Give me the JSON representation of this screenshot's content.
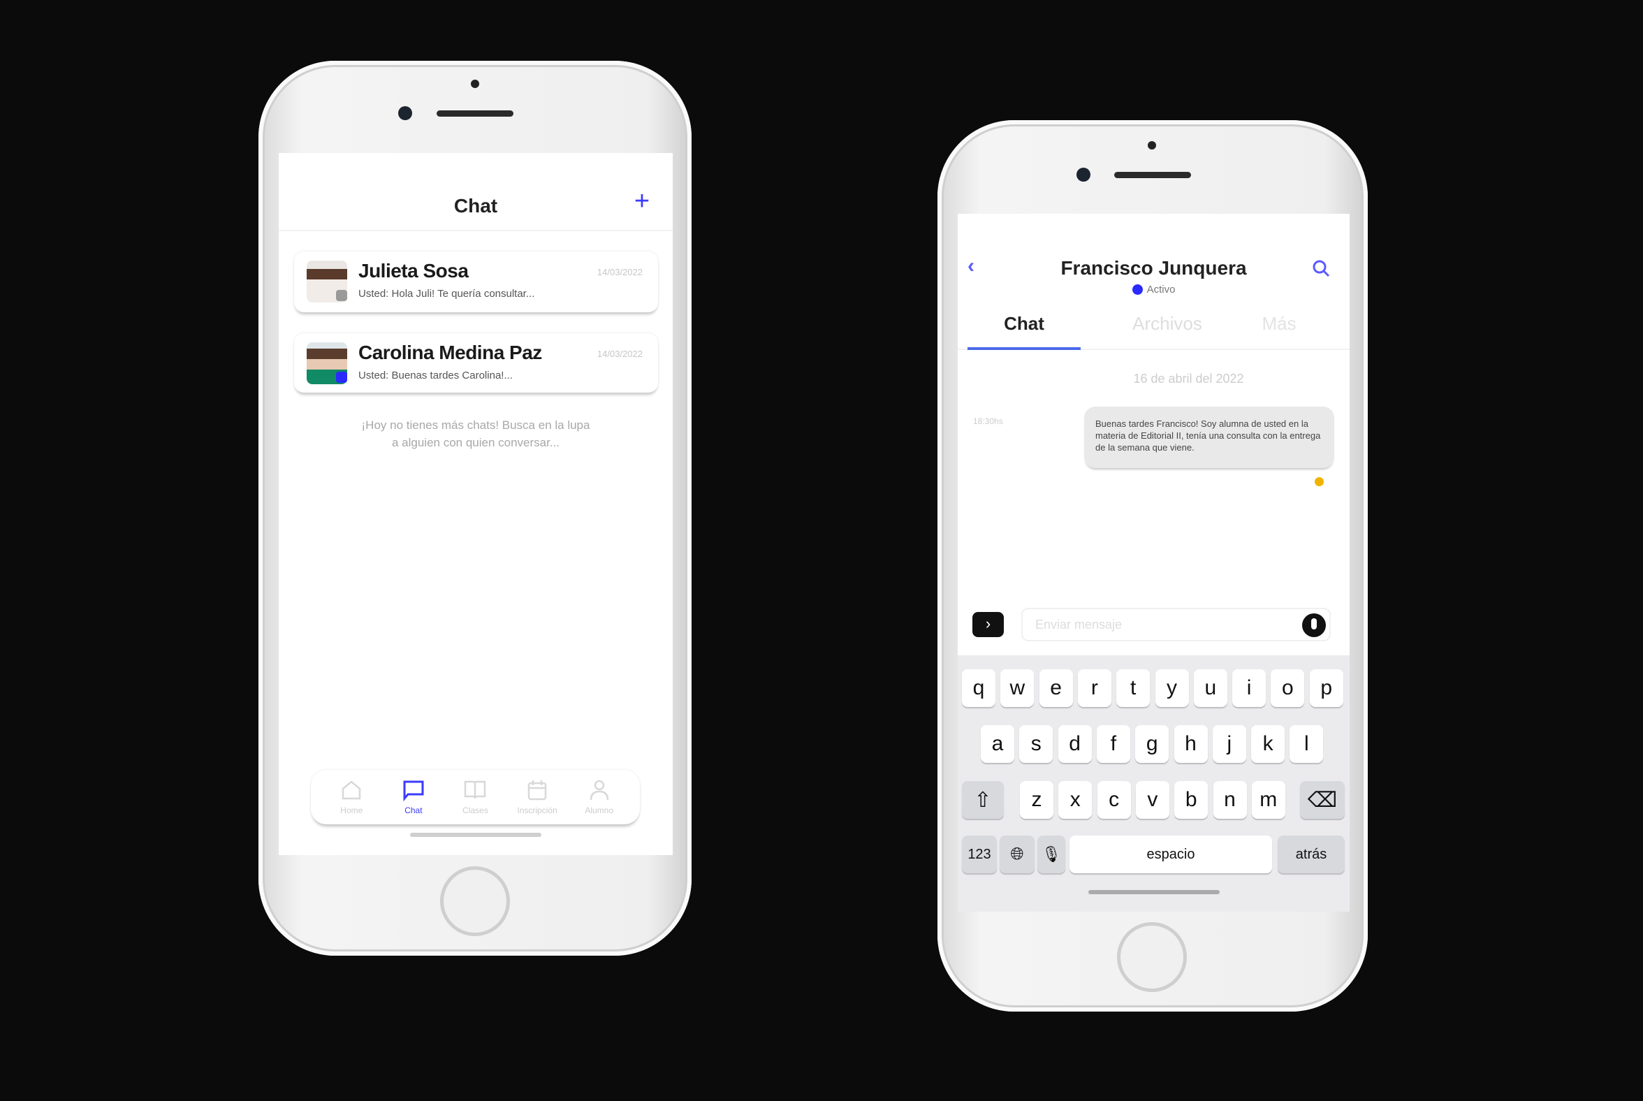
{
  "left_phone": {
    "header": {
      "title": "Chat",
      "add_icon": "plus-icon"
    },
    "chats": [
      {
        "name": "Julieta Sosa",
        "preview": "Usted: Hola Juli! Te quería consultar...",
        "date": "14/03/2022",
        "status_color": "#9a9a9a"
      },
      {
        "name": "Carolina Medina Paz",
        "preview": "Usted: Buenas tardes Carolina!...",
        "date": "14/03/2022",
        "status_color": "#2a2aff"
      }
    ],
    "empty_message": [
      "¡Hoy no tienes más chats! Busca en la lupa",
      "a alguien con quien conversar..."
    ],
    "tabbar": [
      {
        "label": "Home",
        "icon": "home-icon"
      },
      {
        "label": "Chat",
        "icon": "chat-icon",
        "active": true
      },
      {
        "label": "Clases",
        "icon": "book-icon"
      },
      {
        "label": "Inscripción",
        "icon": "calendar-icon"
      },
      {
        "label": "Alumno",
        "icon": "user-icon"
      }
    ]
  },
  "right_phone": {
    "header": {
      "contact_name": "Francisco Junquera",
      "status": "Activo",
      "back_icon": "chevron-left-icon",
      "search_icon": "search-icon"
    },
    "tabs": [
      {
        "label": "Chat",
        "active": true
      },
      {
        "label": "Archivos"
      },
      {
        "label": "Más"
      }
    ],
    "date_separator": "16 de abril del 2022",
    "messages": [
      {
        "time": "18:30hs",
        "text": "Buenas tardes Francisco! Soy alumna de usted en la materia de Editorial II, tenía una consulta con la entrega de la semana que viene.",
        "reaction": "emoji"
      }
    ],
    "composer": {
      "placeholder": "Enviar mensaje",
      "expand_icon": "chevron-right-icon",
      "mic_icon": "microphone-icon"
    },
    "keyboard": {
      "row1": [
        "q",
        "w",
        "e",
        "r",
        "t",
        "y",
        "u",
        "i",
        "o",
        "p"
      ],
      "row2": [
        "a",
        "s",
        "d",
        "f",
        "g",
        "h",
        "j",
        "k",
        "l"
      ],
      "row3": [
        "z",
        "x",
        "c",
        "v",
        "b",
        "n",
        "m"
      ],
      "numbers": "123",
      "space": "espacio",
      "return": "atrás"
    },
    "accent_color": "#3b3bff"
  }
}
